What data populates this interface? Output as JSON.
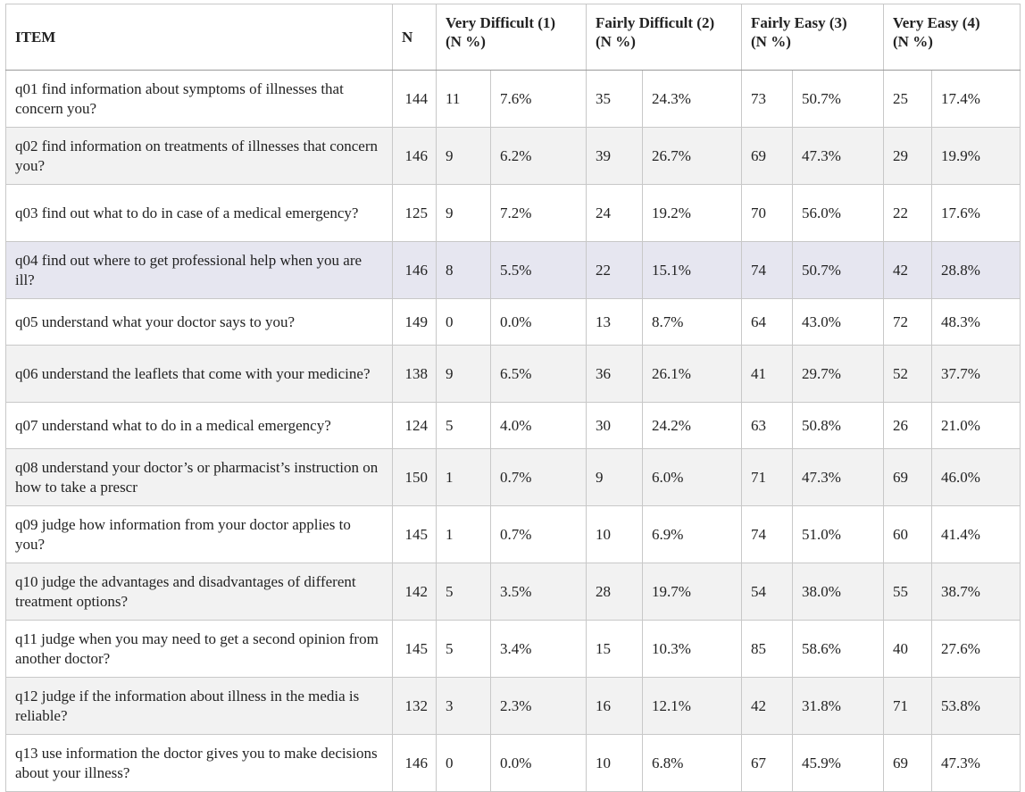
{
  "table": {
    "headers": {
      "item": "ITEM",
      "n": "N",
      "groups": [
        {
          "title": "Very Difficult (1)",
          "sub": "(N %)"
        },
        {
          "title": "Fairly Difficult (2)",
          "sub": "(N %)"
        },
        {
          "title": "Fairly Easy (3)",
          "sub": "(N %)"
        },
        {
          "title": "Very Easy (4)",
          "sub": "(N %)"
        }
      ]
    },
    "rows": [
      {
        "item": "q01 find information about symptoms of illnesses that concern you?",
        "n": "144",
        "vals": [
          "11",
          "7.6%",
          "35",
          "24.3%",
          "73",
          "50.7%",
          "25",
          "17.4%"
        ]
      },
      {
        "item": "q02 find information on treatments of illnesses that concern you?",
        "n": "146",
        "vals": [
          "9",
          "6.2%",
          "39",
          "26.7%",
          "69",
          "47.3%",
          "29",
          "19.9%"
        ]
      },
      {
        "item": "q03 find out what to do in case of a medical emergency?",
        "n": "125",
        "vals": [
          "9",
          "7.2%",
          "24",
          "19.2%",
          "70",
          "56.0%",
          "22",
          "17.6%"
        ]
      },
      {
        "item": "q04 find out where to get professional help when you are ill?",
        "n": "146",
        "vals": [
          "8",
          "5.5%",
          "22",
          "15.1%",
          "74",
          "50.7%",
          "42",
          "28.8%"
        ]
      },
      {
        "item": "q05 understand what your doctor says to you?",
        "n": "149",
        "vals": [
          "0",
          "0.0%",
          "13",
          "8.7%",
          "64",
          "43.0%",
          "72",
          "48.3%"
        ]
      },
      {
        "item": "q06 understand the leaflets that come with your medicine?",
        "n": "138",
        "vals": [
          "9",
          "6.5%",
          "36",
          "26.1%",
          "41",
          "29.7%",
          "52",
          "37.7%"
        ]
      },
      {
        "item": "q07 understand what to do in a medical emergency?",
        "n": "124",
        "vals": [
          "5",
          "4.0%",
          "30",
          "24.2%",
          "63",
          "50.8%",
          "26",
          "21.0%"
        ]
      },
      {
        "item": "q08 understand your doctor’s or pharmacist’s instruction on how to take a prescr",
        "n": "150",
        "vals": [
          "1",
          "0.7%",
          "9",
          "6.0%",
          "71",
          "47.3%",
          "69",
          "46.0%"
        ]
      },
      {
        "item": "q09 judge how information from your doctor applies to you?",
        "n": "145",
        "vals": [
          "1",
          "0.7%",
          "10",
          "6.9%",
          "74",
          "51.0%",
          "60",
          "41.4%"
        ]
      },
      {
        "item": "q10 judge the advantages and disadvantages of different treatment options?",
        "n": "142",
        "vals": [
          "5",
          "3.5%",
          "28",
          "19.7%",
          "54",
          "38.0%",
          "55",
          "38.7%"
        ]
      },
      {
        "item": "q11 judge when you may need to get a second opinion from another doctor?",
        "n": "145",
        "vals": [
          "5",
          "3.4%",
          "15",
          "10.3%",
          "85",
          "58.6%",
          "40",
          "27.6%"
        ]
      },
      {
        "item": "q12 judge if the information about illness in the media is reliable?",
        "n": "132",
        "vals": [
          "3",
          "2.3%",
          "16",
          "12.1%",
          "42",
          "31.8%",
          "71",
          "53.8%"
        ]
      },
      {
        "item": "q13 use information the doctor gives you to make decisions about your illness?",
        "n": "146",
        "vals": [
          "0",
          "0.0%",
          "10",
          "6.8%",
          "67",
          "45.9%",
          "69",
          "47.3%"
        ]
      }
    ],
    "highlighted_row": 3
  }
}
